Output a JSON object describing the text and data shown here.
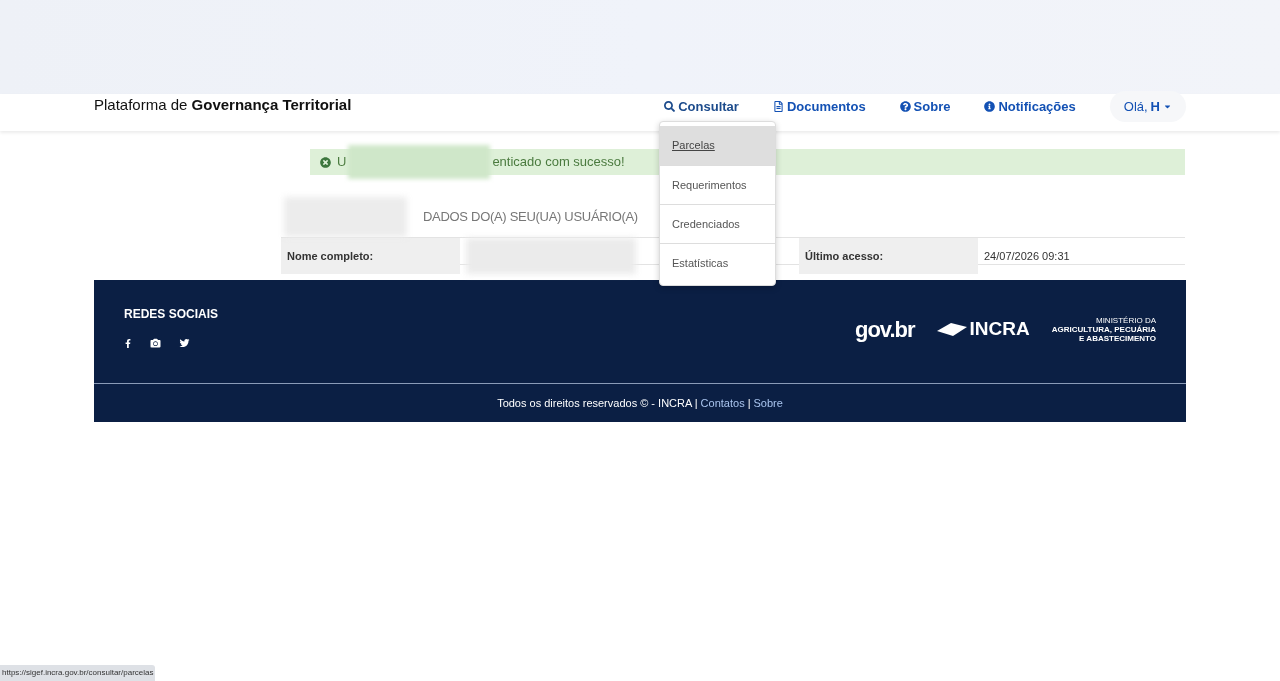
{
  "header": {
    "title_plain": "Plataforma de",
    "title_bold": "Governança Territorial",
    "nav": [
      {
        "kind": "search",
        "label": "Consultar",
        "expanded": true
      },
      {
        "kind": "document",
        "label": "Documentos",
        "expanded": false
      },
      {
        "kind": "question",
        "label": "Sobre",
        "expanded": false
      },
      {
        "kind": "info",
        "label": "Notificações",
        "expanded": false
      }
    ],
    "user": {
      "greeting": "Olá,",
      "name": "H"
    }
  },
  "dropdown": {
    "items": [
      {
        "label": "Parcelas",
        "selected": true
      },
      {
        "label": "Requerimentos",
        "selected": false
      },
      {
        "label": "Credenciados",
        "selected": false
      },
      {
        "label": "Estatísticas",
        "selected": false
      }
    ]
  },
  "alert": {
    "text_start": "U",
    "text_end": "enticado com sucesso!"
  },
  "user_data": {
    "heading": "DADOS DO(A) SEU(UA) USUÁRIO(A)",
    "fields": [
      {
        "label": "Nome completo:"
      },
      {
        "label": "Último acesso:",
        "value": "24/07/2026 09:31"
      }
    ]
  },
  "footer": {
    "social_title": "REDES SOCIAIS",
    "logos": {
      "govbr": "gov.br",
      "incra": "INCRA",
      "ministry": [
        "MINISTÉRIO DA",
        "AGRICULTURA, PECUÁRIA",
        "E ABASTECIMENTO"
      ]
    },
    "copyright": "Todos os direitos reservados © - INCRA |",
    "links": [
      "Contatos",
      "Sobre"
    ],
    "separator": "|"
  },
  "status_url": "https://sigef.incra.gov.br/consultar/parcelas"
}
